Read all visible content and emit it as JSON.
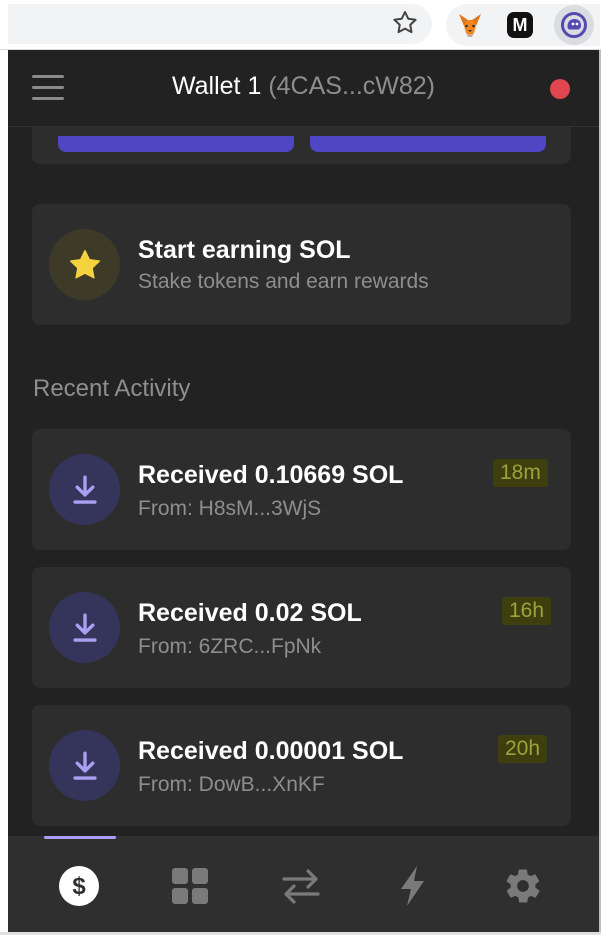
{
  "browser": {
    "bookmark_icon": "star-outline-icon",
    "extensions": [
      "metamask-fox-icon",
      "m-extension-icon",
      "phantom-ghost-icon"
    ],
    "extension_m_label": "M"
  },
  "header": {
    "wallet_name": "Wallet 1",
    "wallet_address": "(4CAS...cW82)",
    "menu_icon": "hamburger-menu-icon",
    "status_color": "#e0464f"
  },
  "earn": {
    "title": "Start earning SOL",
    "subtitle": "Stake tokens and earn rewards",
    "icon": "star-icon"
  },
  "recent_activity": {
    "title": "Recent Activity",
    "items": [
      {
        "title": "Received 0.10669 SOL",
        "from": "From: H8sM...3WjS",
        "time": "18m"
      },
      {
        "title": "Received 0.02 SOL",
        "from": "From: 6ZRC...FpNk",
        "time": "16h"
      },
      {
        "title": "Received 0.00001 SOL",
        "from": "From: DowB...XnKF",
        "time": "20h"
      }
    ]
  },
  "tabs": [
    {
      "id": "wallet",
      "icon": "dollar-icon",
      "active": true
    },
    {
      "id": "collectibles",
      "icon": "grid-icon",
      "active": false
    },
    {
      "id": "swap",
      "icon": "swap-arrows-icon",
      "active": false
    },
    {
      "id": "activity",
      "icon": "lightning-icon",
      "active": false
    },
    {
      "id": "settings",
      "icon": "gear-icon",
      "active": false
    }
  ],
  "colors": {
    "accent": "#ab9ff2",
    "button": "#4f46c4",
    "background": "#222222",
    "card": "#2d2d2d",
    "highlight": "#3e3f0e"
  }
}
